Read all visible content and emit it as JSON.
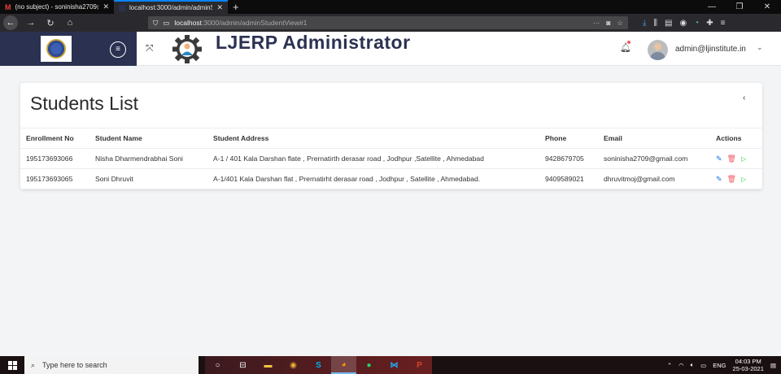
{
  "browser": {
    "tabs": [
      {
        "title": "(no subject) - soninisha2709@g",
        "icon": "gmail-icon"
      },
      {
        "title": "localhost:3000/admin/adminSt",
        "icon": "page-icon"
      }
    ],
    "url_host": "localhost",
    "url_path": ":3000/admin/adminStudentView#1"
  },
  "header": {
    "app_title": "LJERP Administrator",
    "user_email": "admin@ljinstitute.in"
  },
  "card": {
    "title": "Students List",
    "columns": [
      "Enrollment No",
      "Student Name",
      "Student Address",
      "Phone",
      "Email",
      "Actions"
    ],
    "rows": [
      {
        "enrollment": "195173693066",
        "name": "Nisha Dharmendrabhai Soni",
        "address": "A-1 / 401 Kala Darshan flate , Prernatirth derasar road , Jodhpur ,Satellite , Ahmedabad",
        "phone": "9428679705",
        "email": "soninisha2709@gmail.com"
      },
      {
        "enrollment": "195173693065",
        "name": "Soni Dhruvit",
        "address": "A-1/401 Kala Darshan flat , Prernatirht derasar road , Jodhpur , Satellite , Ahmedabad.",
        "phone": "9409589021",
        "email": "dhruvitmoj@gmail.com"
      }
    ]
  },
  "taskbar": {
    "search_placeholder": "Type here to search",
    "lang": "ENG",
    "time": "04:03 PM",
    "date": "25-03-2021"
  },
  "colors": {
    "brand_dark": "#2b3151",
    "edit": "#1572e8",
    "delete": "#f25961",
    "view": "#31ce36"
  }
}
